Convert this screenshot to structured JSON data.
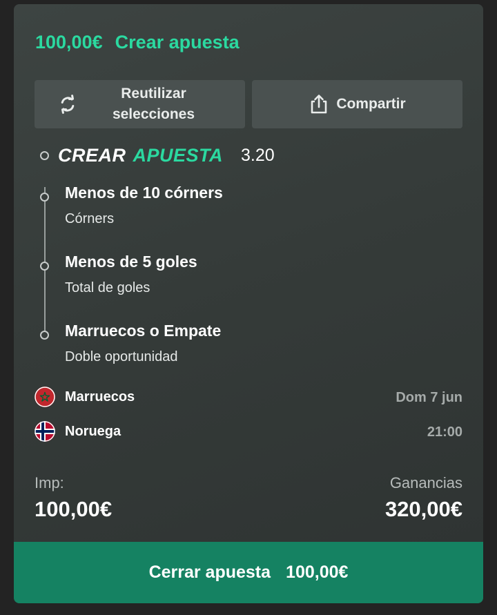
{
  "header": {
    "amount": "100,00€",
    "title": "Crear apuesta"
  },
  "actions": {
    "reuse_line1": "Reutilizar",
    "reuse_line2": "selecciones",
    "share": "Compartir"
  },
  "bet": {
    "brand_word1": "CREAR",
    "brand_word2": "APUESTA",
    "odds": "3.20",
    "selections": [
      {
        "title": "Menos de 10 córners",
        "market": "Córners"
      },
      {
        "title": "Menos de 5 goles",
        "market": "Total de goles"
      },
      {
        "title": "Marruecos o Empate",
        "market": "Doble oportunidad"
      }
    ]
  },
  "match": {
    "home": {
      "name": "Marruecos",
      "flag": "morocco-flag-icon"
    },
    "away": {
      "name": "Noruega",
      "flag": "norway-flag-icon"
    },
    "date": "Dom 7 jun",
    "time": "21:00"
  },
  "stake": {
    "label": "Imp:",
    "value": "100,00€"
  },
  "winnings": {
    "label": "Ganancias",
    "value": "320,00€"
  },
  "cashout": {
    "label": "Cerrar apuesta",
    "amount": "100,00€"
  },
  "colors": {
    "accent": "#2bd9a0",
    "button_green": "#158262",
    "card_bg": "#3a403e"
  }
}
